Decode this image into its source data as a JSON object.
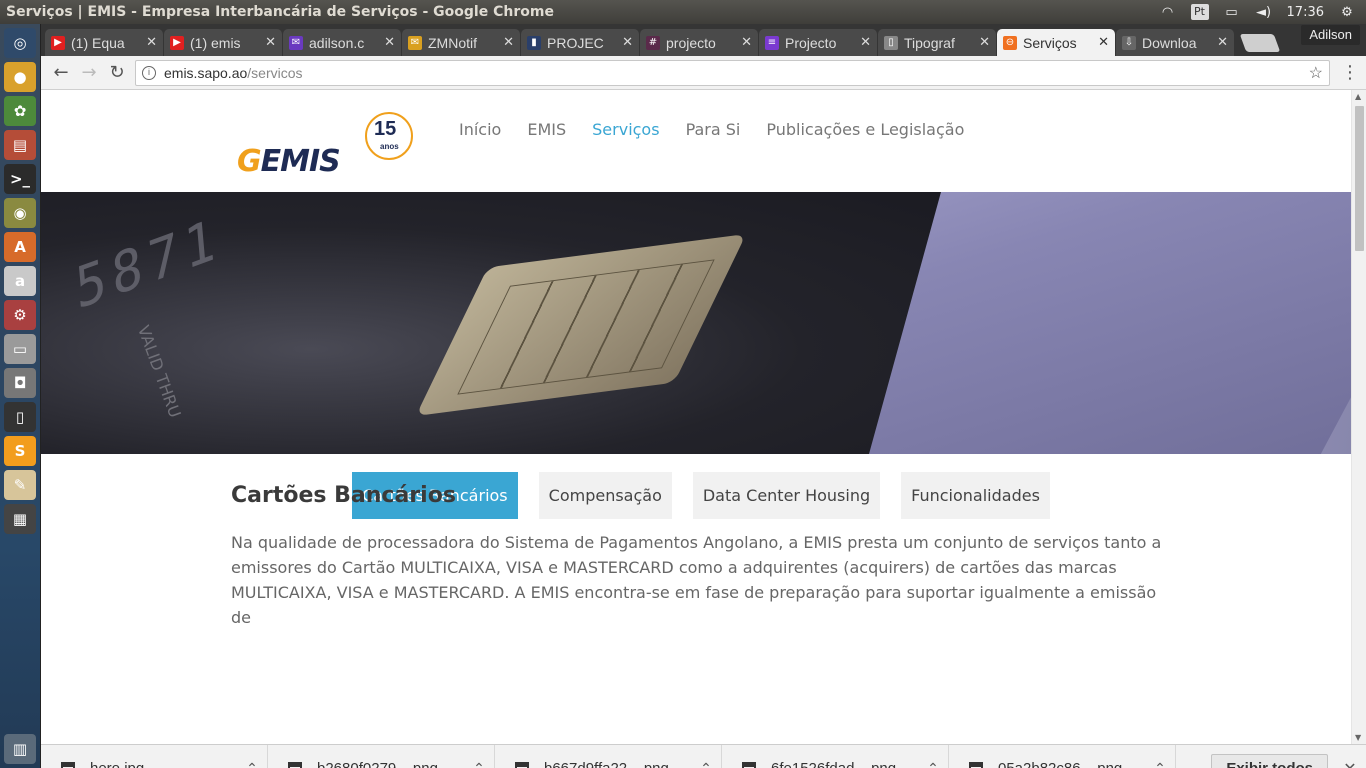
{
  "window": {
    "title": "Serviços | EMIS - Empresa Interbancária de Serviços - Google Chrome",
    "time": "17:36",
    "keyboard_layout": "Pt"
  },
  "launcher": [
    {
      "name": "dash-home-icon",
      "glyph": "◎",
      "color": "#2f4a6a"
    },
    {
      "name": "chrome-icon",
      "glyph": "●",
      "color": "#d9a12c"
    },
    {
      "name": "photos-icon",
      "glyph": "✿",
      "color": "#4d8a3b"
    },
    {
      "name": "files-icon",
      "glyph": "▤",
      "color": "#b54d38"
    },
    {
      "name": "terminal-icon",
      "glyph": ">_",
      "color": "#2b2b2b"
    },
    {
      "name": "webcam-icon",
      "glyph": "◉",
      "color": "#8a8a40"
    },
    {
      "name": "software-center-icon",
      "glyph": "A",
      "color": "#d76b2a"
    },
    {
      "name": "amazon-icon",
      "glyph": "a",
      "color": "#c9c9c9"
    },
    {
      "name": "settings-icon",
      "glyph": "⚙",
      "color": "#a94040"
    },
    {
      "name": "drive-icon",
      "glyph": "▭",
      "color": "#9a9a9a"
    },
    {
      "name": "camera-icon",
      "glyph": "◘",
      "color": "#777"
    },
    {
      "name": "phone-icon",
      "glyph": "▯",
      "color": "#333"
    },
    {
      "name": "sublime-icon",
      "glyph": "S",
      "color": "#f29d1d"
    },
    {
      "name": "text-editor-icon",
      "glyph": "✎",
      "color": "#d7c59a"
    },
    {
      "name": "video-editor-icon",
      "glyph": "▦",
      "color": "#444"
    }
  ],
  "tabs": [
    {
      "label": "(1) Equa",
      "fav": "▶",
      "fav_color": "#e02020",
      "active": false
    },
    {
      "label": "(1) emis",
      "fav": "▶",
      "fav_color": "#e02020",
      "active": false
    },
    {
      "label": "adilson.c",
      "fav": "✉",
      "fav_color": "#6a3ac0",
      "active": false
    },
    {
      "label": "ZMNotif",
      "fav": "✉",
      "fav_color": "#d9a020",
      "active": false
    },
    {
      "label": "PROJEC",
      "fav": "▮",
      "fav_color": "#2a3f6a",
      "active": false
    },
    {
      "label": "projecto",
      "fav": "#",
      "fav_color": "#5a2a4a",
      "active": false
    },
    {
      "label": "Projecto",
      "fav": "≡",
      "fav_color": "#7a3ad0",
      "active": false
    },
    {
      "label": "Tipograf",
      "fav": "▯",
      "fav_color": "#888",
      "active": false
    },
    {
      "label": "Serviços",
      "fav": "⊖",
      "fav_color": "#f07020",
      "active": true
    },
    {
      "label": "Downloa",
      "fav": "⇩",
      "fav_color": "#666",
      "active": false
    }
  ],
  "profile_name": "Adilson",
  "address": {
    "host": "emis.sapo.ao",
    "path": "/servicos"
  },
  "site": {
    "logo_text": "EMIS",
    "logo_g": "G",
    "badge_number": "15",
    "badge_label": "anos",
    "nav": [
      {
        "label": "Início",
        "active": false
      },
      {
        "label": "EMIS",
        "active": false
      },
      {
        "label": "Serviços",
        "active": true
      },
      {
        "label": "Para Si",
        "active": false
      },
      {
        "label": "Publicações e Legislação",
        "active": false
      }
    ],
    "hero_emboss": "5871",
    "hero_valid": "VALID THRU",
    "service_tabs": [
      {
        "label": "Cartões Bancários",
        "active": true
      },
      {
        "label": "Compensação",
        "active": false
      },
      {
        "label": "Data Center Housing",
        "active": false
      },
      {
        "label": "Funcionalidades",
        "active": false
      }
    ],
    "section_title": "Cartões Bancários",
    "section_body": "Na qualidade de processadora do Sistema de Pagamentos Angolano, a EMIS presta um conjunto de serviços tanto a emissores do Cartão MULTICAIXA, VISA e MASTERCARD como a adquirentes (acquirers) de cartões das marcas MULTICAIXA, VISA e MASTERCARD. A EMIS encontra-se em fase de preparação para suportar igualmente a emissão de"
  },
  "downloads": [
    {
      "name": "hero.jpg"
    },
    {
      "name": "b2680f0279....png"
    },
    {
      "name": "b667d9ffa22....png"
    },
    {
      "name": "6fe1526fdad....png"
    },
    {
      "name": "05a2b82c86....png"
    }
  ],
  "show_all_label": "Exibir todos"
}
